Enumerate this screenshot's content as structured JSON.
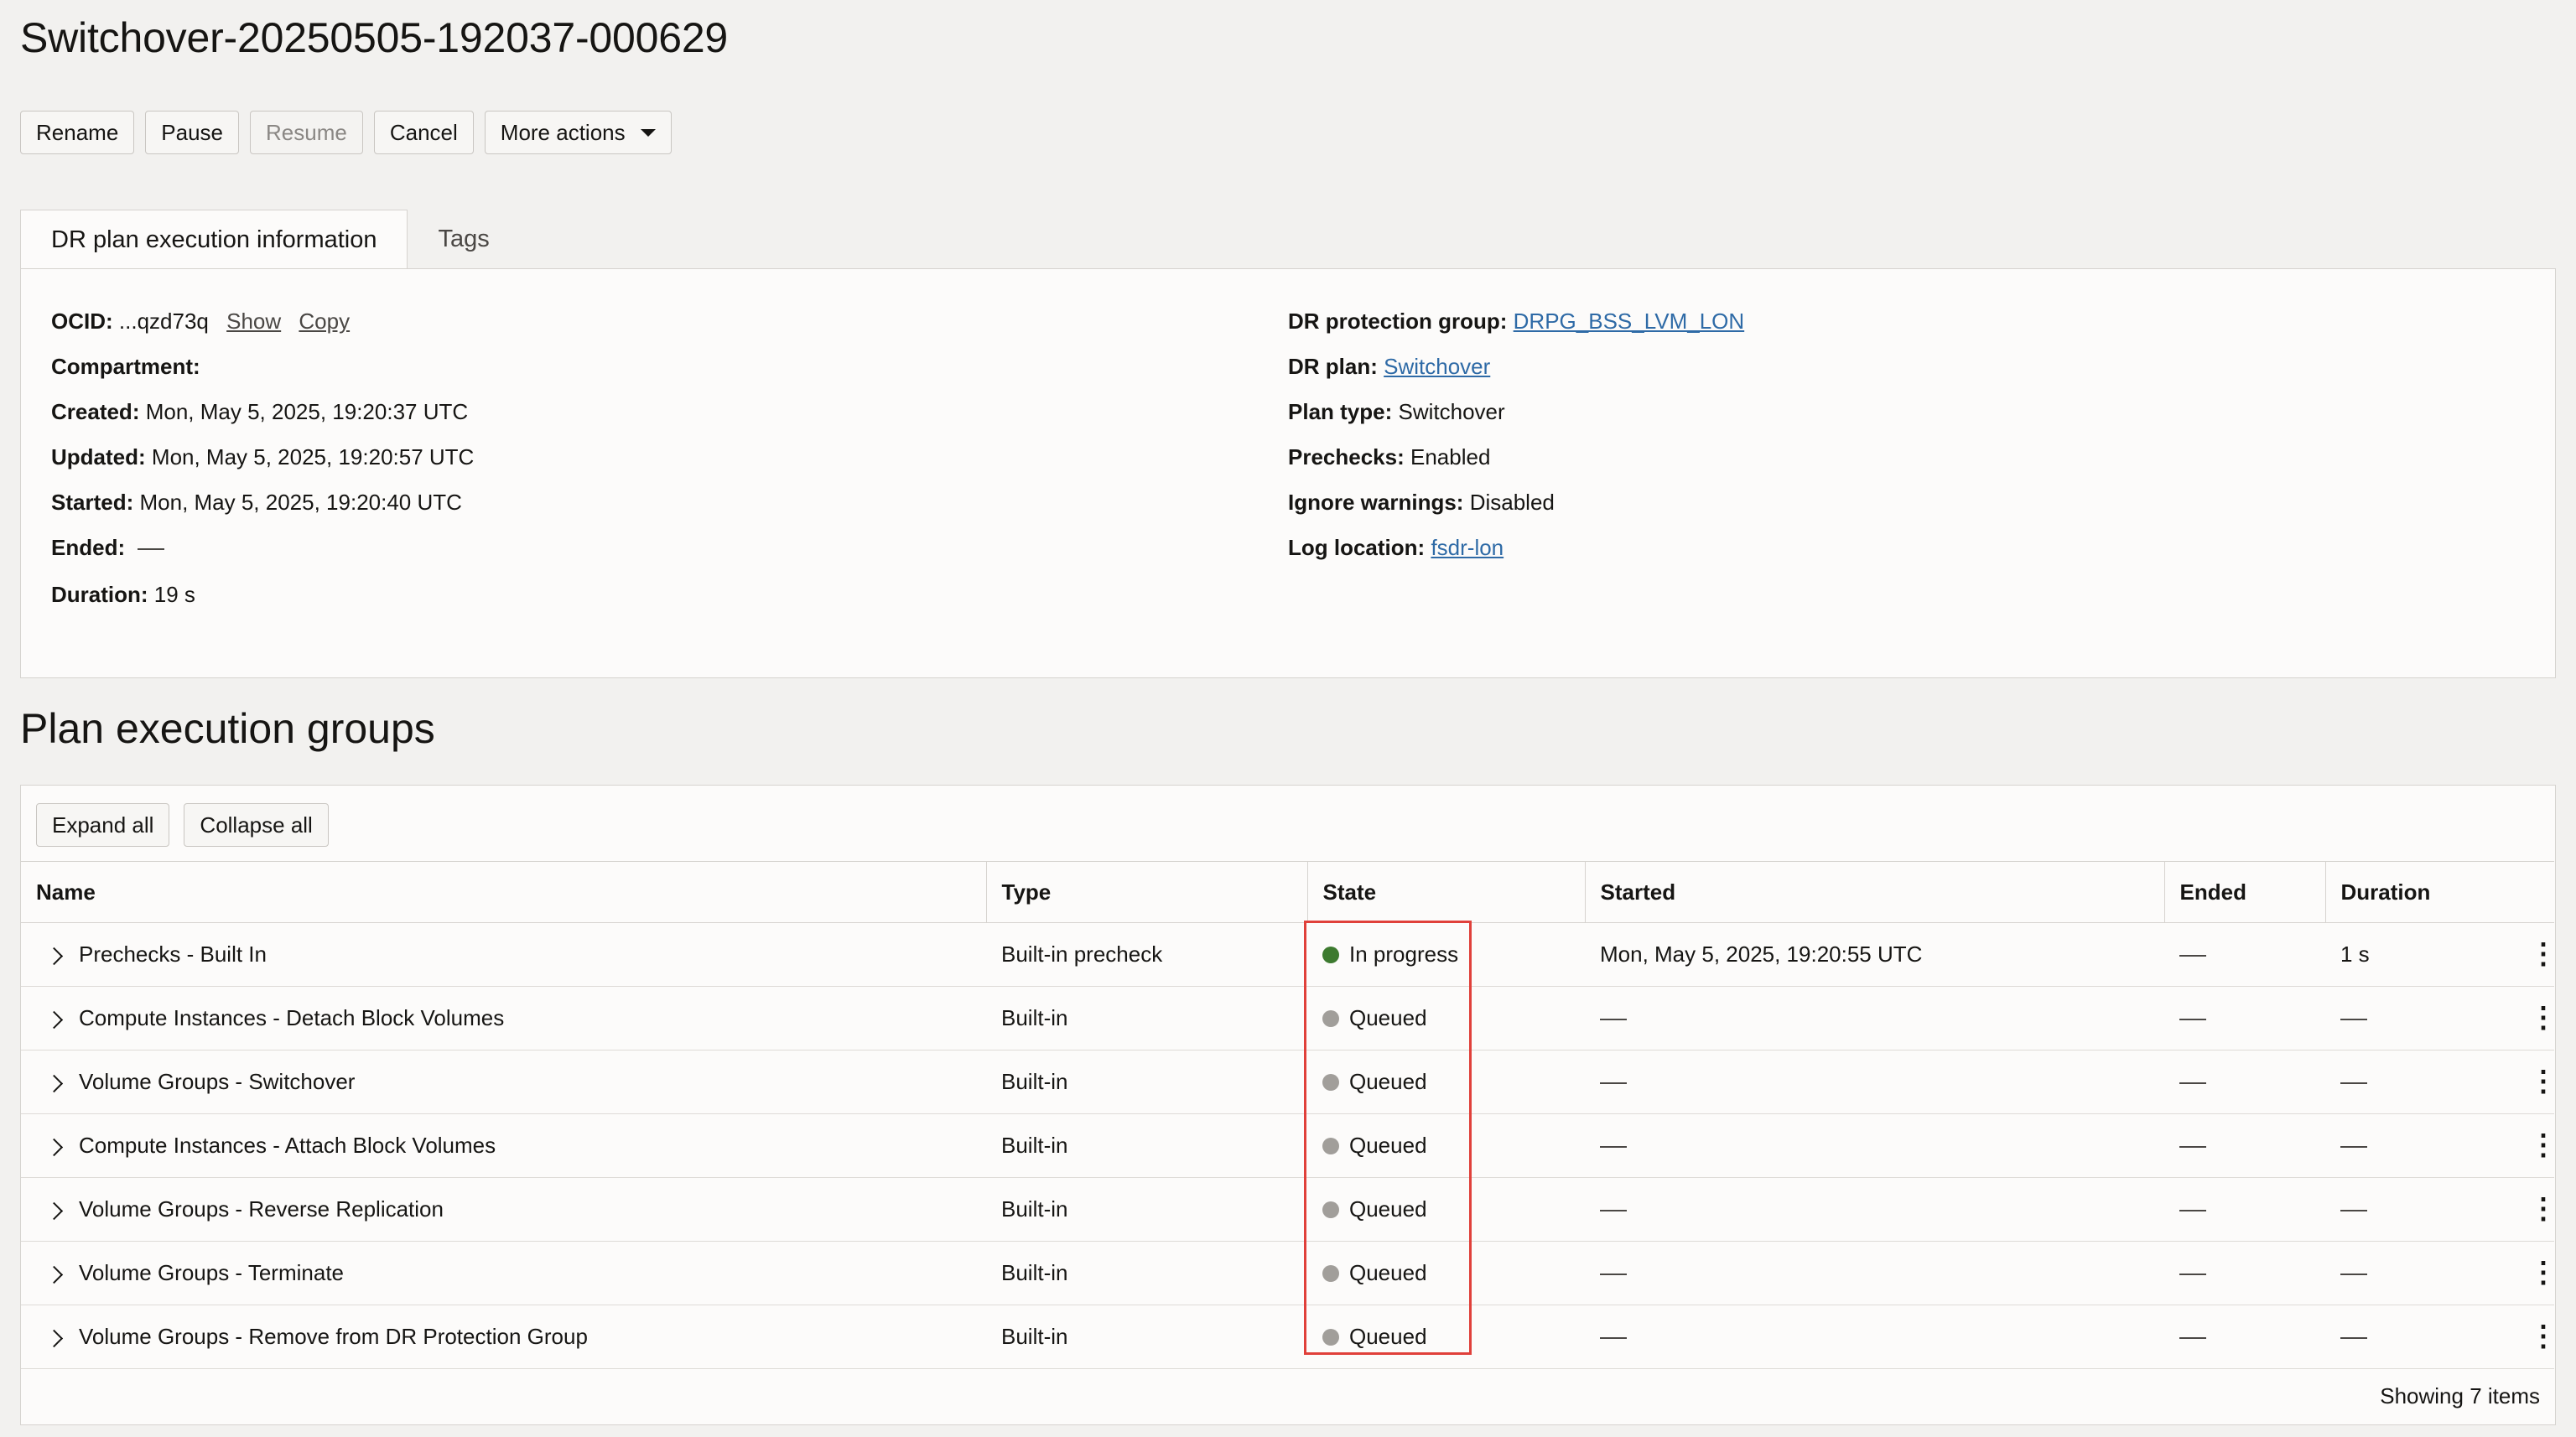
{
  "page": {
    "title": "Switchover-20250505-192037-000629"
  },
  "toolbar": {
    "rename": "Rename",
    "pause": "Pause",
    "resume": "Resume",
    "cancel": "Cancel",
    "more_actions": "More actions"
  },
  "tabs": {
    "info": "DR plan execution information",
    "tags": "Tags"
  },
  "info": {
    "left": {
      "ocid_label": "OCID:",
      "ocid_value": "...qzd73q",
      "show": "Show",
      "copy": "Copy",
      "compartment_label": "Compartment:",
      "created_label": "Created:",
      "created_value": "Mon, May 5, 2025, 19:20:37 UTC",
      "updated_label": "Updated:",
      "updated_value": "Mon, May 5, 2025, 19:20:57 UTC",
      "started_label": "Started:",
      "started_value": "Mon, May 5, 2025, 19:20:40 UTC",
      "ended_label": "Ended:",
      "duration_label": "Duration:",
      "duration_value": "19 s"
    },
    "right": {
      "protection_group_label": "DR protection group:",
      "protection_group_value": "DRPG_BSS_LVM_LON",
      "dr_plan_label": "DR plan:",
      "dr_plan_value": "Switchover",
      "plan_type_label": "Plan type:",
      "plan_type_value": "Switchover",
      "prechecks_label": "Prechecks:",
      "prechecks_value": "Enabled",
      "ignore_warnings_label": "Ignore warnings:",
      "ignore_warnings_value": "Disabled",
      "log_location_label": "Log location:",
      "log_location_value": "fsdr-lon"
    }
  },
  "groups": {
    "title": "Plan execution groups",
    "expand_all": "Expand all",
    "collapse_all": "Collapse all",
    "columns": [
      "Name",
      "Type",
      "State",
      "Started",
      "Ended",
      "Duration"
    ],
    "rows": [
      {
        "name": "Prechecks - Built In",
        "type": "Built-in precheck",
        "state": "In progress",
        "state_color": "#3d7a2f",
        "started": "Mon, May 5, 2025, 19:20:55 UTC",
        "ended": "",
        "duration": "1 s"
      },
      {
        "name": "Compute Instances - Detach Block Volumes",
        "type": "Built-in",
        "state": "Queued",
        "state_color": "#a19e9a",
        "started": "",
        "ended": "",
        "duration": ""
      },
      {
        "name": "Volume Groups - Switchover",
        "type": "Built-in",
        "state": "Queued",
        "state_color": "#a19e9a",
        "started": "",
        "ended": "",
        "duration": ""
      },
      {
        "name": "Compute Instances - Attach Block Volumes",
        "type": "Built-in",
        "state": "Queued",
        "state_color": "#a19e9a",
        "started": "",
        "ended": "",
        "duration": ""
      },
      {
        "name": "Volume Groups - Reverse Replication",
        "type": "Built-in",
        "state": "Queued",
        "state_color": "#a19e9a",
        "started": "",
        "ended": "",
        "duration": ""
      },
      {
        "name": "Volume Groups - Terminate",
        "type": "Built-in",
        "state": "Queued",
        "state_color": "#a19e9a",
        "started": "",
        "ended": "",
        "duration": ""
      },
      {
        "name": "Volume Groups - Remove from DR Protection Group",
        "type": "Built-in",
        "state": "Queued",
        "state_color": "#a19e9a",
        "started": "",
        "ended": "",
        "duration": ""
      }
    ],
    "footer": "Showing 7 items"
  },
  "colors": {
    "link": "#2e6aa6",
    "highlight": "#e0403a"
  }
}
